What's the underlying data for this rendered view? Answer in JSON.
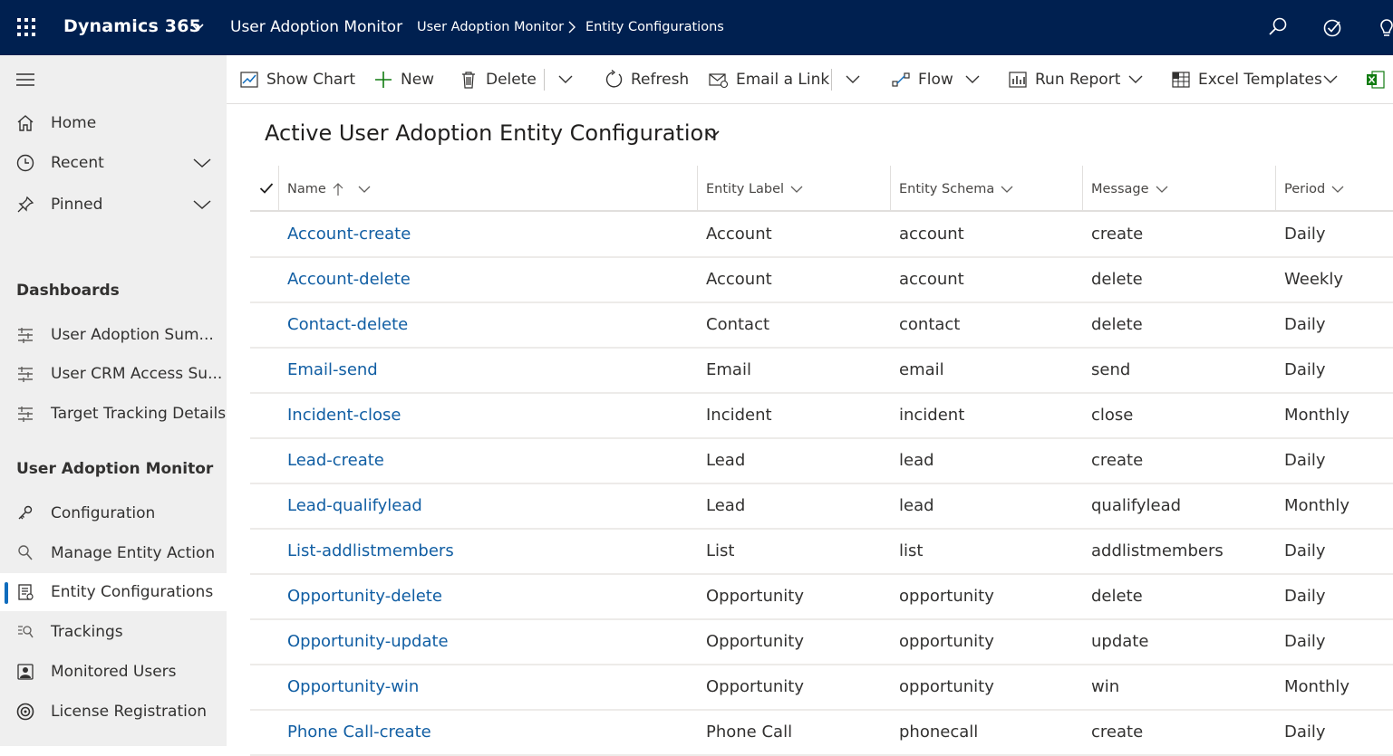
{
  "topbar": {
    "brand": "Dynamics 365",
    "app_name": "User Adoption Monitor",
    "breadcrumb": [
      "User Adoption Monitor",
      "Entity Configurations"
    ],
    "icons": [
      "search-icon",
      "task-icon",
      "lightbulb-icon"
    ]
  },
  "sidebar": {
    "top_items": [
      {
        "label": "Home",
        "icon": "home-icon"
      },
      {
        "label": "Recent",
        "icon": "clock-icon"
      },
      {
        "label": "Pinned",
        "icon": "pin-icon"
      }
    ],
    "dashboards": {
      "title": "Dashboards",
      "items": [
        {
          "label": "User Adoption Sum...",
          "icon": "dashboard-icon"
        },
        {
          "label": "User CRM Access Su...",
          "icon": "dashboard-icon"
        },
        {
          "label": "Target Tracking Details",
          "icon": "dashboard-icon"
        }
      ]
    },
    "app_section": {
      "title": "User Adoption Monitor",
      "items": [
        {
          "label": "Configuration",
          "icon": "key-icon"
        },
        {
          "label": "Manage Entity Action",
          "icon": "search-icon"
        },
        {
          "label": "Entity Configurations",
          "icon": "entity-config-icon",
          "selected": true
        },
        {
          "label": "Trackings",
          "icon": "tracking-icon"
        },
        {
          "label": "Monitored Users",
          "icon": "users-icon"
        },
        {
          "label": "License Registration",
          "icon": "license-icon"
        }
      ]
    }
  },
  "commandbar": {
    "show_chart": "Show Chart",
    "new": "New",
    "delete": "Delete",
    "refresh": "Refresh",
    "email_link": "Email a Link",
    "flow": "Flow",
    "run_report": "Run Report",
    "excel_templates": "Excel Templates"
  },
  "view": {
    "title": "Active User Adoption Entity Configuration"
  },
  "grid": {
    "columns": [
      "Name",
      "Entity Label",
      "Entity Schema",
      "Message",
      "Period"
    ],
    "rows": [
      [
        "Account-create",
        "Account",
        "account",
        "create",
        "Daily"
      ],
      [
        "Account-delete",
        "Account",
        "account",
        "delete",
        "Weekly"
      ],
      [
        "Contact-delete",
        "Contact",
        "contact",
        "delete",
        "Daily"
      ],
      [
        "Email-send",
        "Email",
        "email",
        "send",
        "Daily"
      ],
      [
        "Incident-close",
        "Incident",
        "incident",
        "close",
        "Monthly"
      ],
      [
        "Lead-create",
        "Lead",
        "lead",
        "create",
        "Daily"
      ],
      [
        "Lead-qualifylead",
        "Lead",
        "lead",
        "qualifylead",
        "Monthly"
      ],
      [
        "List-addlistmembers",
        "List",
        "list",
        "addlistmembers",
        "Daily"
      ],
      [
        "Opportunity-delete",
        "Opportunity",
        "opportunity",
        "delete",
        "Daily"
      ],
      [
        "Opportunity-update",
        "Opportunity",
        "opportunity",
        "update",
        "Daily"
      ],
      [
        "Opportunity-win",
        "Opportunity",
        "opportunity",
        "win",
        "Monthly"
      ],
      [
        "Phone Call-create",
        "Phone Call",
        "phonecall",
        "create",
        "Daily"
      ]
    ]
  },
  "colors": {
    "topbar": "#002050",
    "sidebar": "#efefef",
    "link": "#115ea3",
    "selected_indicator": "#0f6cbd"
  }
}
